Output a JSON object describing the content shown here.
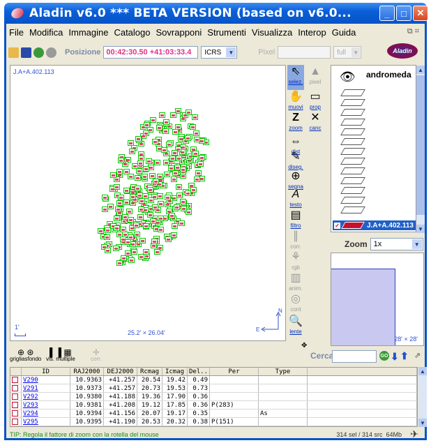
{
  "window": {
    "title": "Aladin v6.0    *** BETA VERSION (based on v6.0...",
    "minimize": "_",
    "maximize": "□",
    "close": "✕"
  },
  "menu": [
    "File",
    "Modifica",
    "Immagine",
    "Catalogo",
    "Sovrapponi",
    "Strumenti",
    "Visualizza",
    "Interop",
    "Guida"
  ],
  "toolbar": {
    "position_label": "Posizione",
    "position_value": "00:42:30.50 +41:03:33.4",
    "frame": "ICRS",
    "pixel_label": "Pixel",
    "pixel_mode": "full",
    "logo": "Aladin"
  },
  "view": {
    "label": "J.A+A.402.113",
    "scale": "1'",
    "dims": "25.2' × 26.04'",
    "compass_n": "N",
    "compass_e": "E"
  },
  "tools": [
    {
      "label": "selez.",
      "icon": "pointer-icon",
      "active": true,
      "enabled": true
    },
    {
      "label": "pixel",
      "icon": "pixel-icon",
      "active": false,
      "enabled": false
    },
    {
      "label": "muovi",
      "icon": "hand-icon",
      "active": false,
      "enabled": true
    },
    {
      "label": "prop",
      "icon": "properties-icon",
      "active": false,
      "enabled": true
    },
    {
      "label": "zoom",
      "icon": "zoom-z-icon",
      "active": false,
      "enabled": true
    },
    {
      "label": "canc",
      "icon": "delete-x-icon",
      "active": false,
      "enabled": true
    },
    {
      "label": "dist",
      "icon": "distance-icon",
      "active": false,
      "enabled": true
    },
    {
      "label": "diseg.",
      "icon": "pencil-icon",
      "active": false,
      "enabled": true
    },
    {
      "label": "segna",
      "icon": "marker-icon",
      "active": false,
      "enabled": true
    },
    {
      "label": "testo",
      "icon": "text-icon",
      "active": false,
      "enabled": true
    },
    {
      "label": "filtro",
      "icon": "filter-icon",
      "active": false,
      "enabled": true
    },
    {
      "label": "corr.",
      "icon": "correlation-icon",
      "active": false,
      "enabled": false
    },
    {
      "label": "rgb",
      "icon": "rgb-icon",
      "active": false,
      "enabled": false
    },
    {
      "label": "anim.",
      "icon": "film-icon",
      "active": false,
      "enabled": false
    },
    {
      "label": "cont",
      "icon": "contour-icon",
      "active": false,
      "enabled": false
    },
    {
      "label": "lente",
      "icon": "magnifier-icon",
      "active": false,
      "enabled": true
    }
  ],
  "stack": {
    "name": "andromeda",
    "active_layer": "J.A+A.402.113"
  },
  "zoom": {
    "label": "Zoom",
    "value": "1x"
  },
  "mini": {
    "dims": "28' × 28'"
  },
  "controls": {
    "background_label": "grigliasfondo",
    "multiview_label": "vis. multiple",
    "corr_label": "corr."
  },
  "search": {
    "label": "Cerca",
    "go": "GO"
  },
  "table": {
    "columns": [
      "",
      "ID",
      "RAJ2000",
      "DEJ2000",
      "Rcmag",
      "Icmag",
      "Del..",
      "Per",
      "Type",
      ""
    ],
    "rows": [
      [
        "V290",
        "10.9363",
        "+41.257",
        "20.54",
        "19.42",
        "0.49",
        "",
        ""
      ],
      [
        "V291",
        "10.9373",
        "+41.257",
        "20.73",
        "19.53",
        "0.73",
        "",
        ""
      ],
      [
        "V292",
        "10.9380",
        "+41.188",
        "19.36",
        "17.90",
        "0.36",
        "",
        ""
      ],
      [
        "V293",
        "10.9381",
        "+41.208",
        "19.12",
        "17.85",
        "0.36",
        "P(283)",
        ""
      ],
      [
        "V294",
        "10.9394",
        "+41.156",
        "20.07",
        "19.17",
        "0.35",
        "",
        "As"
      ],
      [
        "V295",
        "10.9395",
        "+41.190",
        "20.53",
        "20.32",
        "0.38",
        "P(151)",
        ""
      ]
    ]
  },
  "status": {
    "tip": "TIP: Regola il fattore di zoom con la rotella del mouse",
    "selection": "314 sel / 314 src",
    "memory": "64Mb"
  }
}
